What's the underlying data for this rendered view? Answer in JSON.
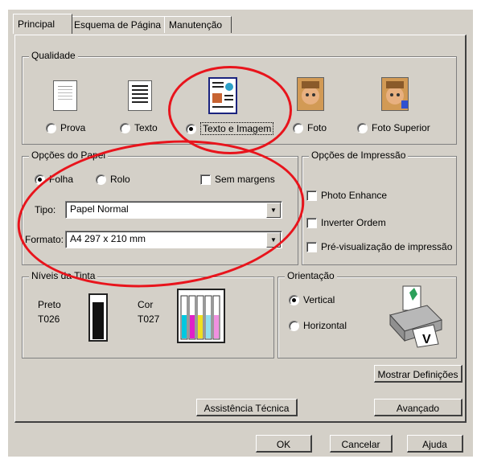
{
  "tabs": [
    "Principal",
    "Esquema de Página",
    "Manutenção"
  ],
  "qualidade": {
    "title": "Qualidade",
    "options": [
      {
        "label": "Prova",
        "selected": false
      },
      {
        "label": "Texto",
        "selected": false
      },
      {
        "label": "Texto e Imagem",
        "selected": true
      },
      {
        "label": "Foto",
        "selected": false
      },
      {
        "label": "Foto Superior",
        "selected": false
      }
    ]
  },
  "opcoes_papel": {
    "title": "Opções do Papel",
    "folha_label": "Folha",
    "rolo_label": "Rolo",
    "sem_margens_label": "Sem margens",
    "tipo_label": "Tipo:",
    "tipo_value": "Papel Normal",
    "formato_label": "Formato:",
    "formato_value": "A4 297 x 210 mm"
  },
  "opcoes_impressao": {
    "title": "Opções de Impressão",
    "items": [
      "Photo Enhance",
      "Inverter Ordem",
      "Pré-visualização de impressão"
    ]
  },
  "niveis_tinta": {
    "title": "Níveis da Tinta",
    "preto_label": "Preto",
    "preto_code": "T026",
    "cor_label": "Cor",
    "cor_code": "T027"
  },
  "orientacao": {
    "title": "Orientação",
    "vertical_label": "Vertical",
    "horizontal_label": "Horizontal",
    "selected": "Vertical"
  },
  "buttons": {
    "mostrar": "Mostrar Definições",
    "assistencia": "Assistência Técnica",
    "avancado": "Avançado",
    "ok": "OK",
    "cancelar": "Cancelar",
    "ajuda": "Ajuda"
  },
  "colors": {
    "dialog_bg": "#d4d0c8",
    "annotation_red": "#e8141c"
  }
}
